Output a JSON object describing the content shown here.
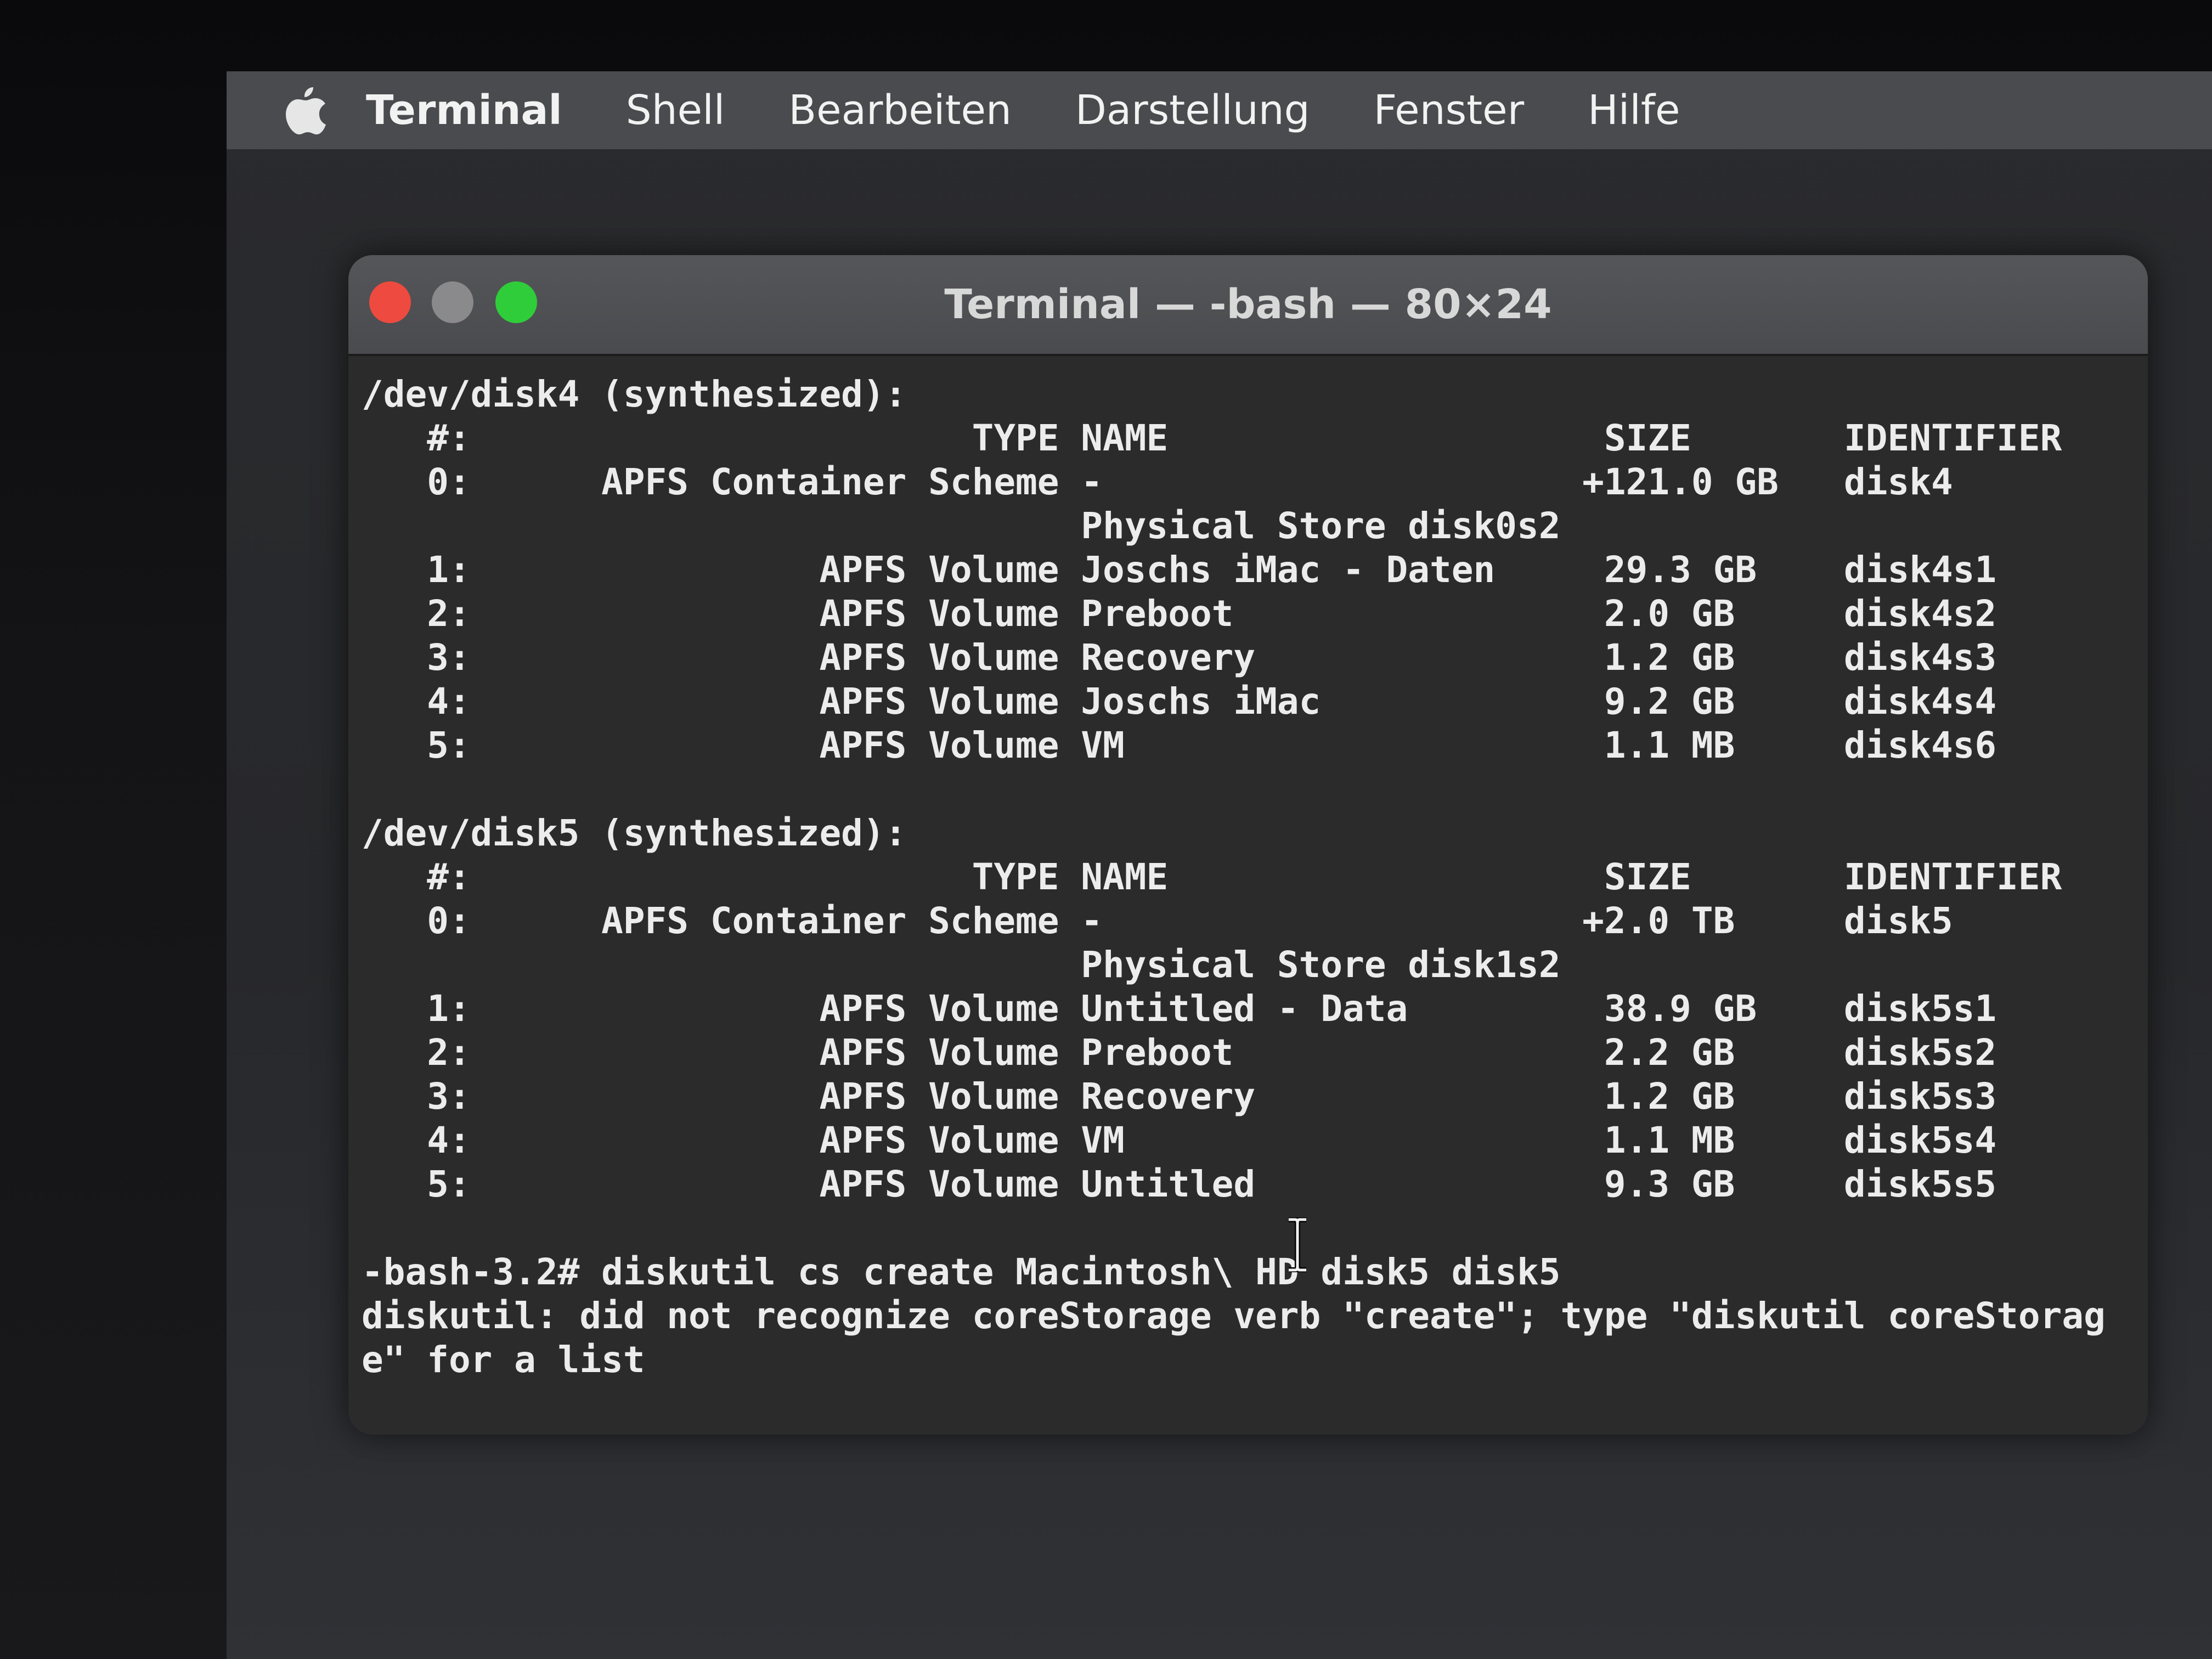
{
  "menubar": {
    "app_name": "Terminal",
    "items": [
      "Shell",
      "Bearbeiten",
      "Darstellung",
      "Fenster",
      "Hilfe"
    ]
  },
  "window": {
    "title": "Terminal — -bash — 80×24"
  },
  "terminal": {
    "lines": [
      "/dev/disk4 (synthesized):",
      "   #:                       TYPE NAME                    SIZE       IDENTIFIER",
      "   0:      APFS Container Scheme -                      +121.0 GB   disk4",
      "                                 Physical Store disk0s2",
      "   1:                APFS Volume Joschs iMac - Daten     29.3 GB    disk4s1",
      "   2:                APFS Volume Preboot                 2.0 GB     disk4s2",
      "   3:                APFS Volume Recovery                1.2 GB     disk4s3",
      "   4:                APFS Volume Joschs iMac             9.2 GB     disk4s4",
      "   5:                APFS Volume VM                      1.1 MB     disk4s6",
      "",
      "/dev/disk5 (synthesized):",
      "   #:                       TYPE NAME                    SIZE       IDENTIFIER",
      "   0:      APFS Container Scheme -                      +2.0 TB     disk5",
      "                                 Physical Store disk1s2",
      "   1:                APFS Volume Untitled - Data         38.9 GB    disk5s1",
      "   2:                APFS Volume Preboot                 2.2 GB     disk5s2",
      "   3:                APFS Volume Recovery                1.2 GB     disk5s3",
      "   4:                APFS Volume VM                      1.1 MB     disk5s4",
      "   5:                APFS Volume Untitled                9.3 GB     disk5s5",
      "",
      "-bash-3.2# diskutil cs create Macintosh\\ HD disk5 disk5",
      "diskutil: did not recognize coreStorage verb \"create\"; type \"diskutil coreStorag",
      "e\" for a list"
    ]
  },
  "colors": {
    "menubar_bg": "#4a4b4e",
    "terminal_bg": "#2b2b2b",
    "text": "#ececec",
    "close": "#ee4a3f",
    "minimize": "#8a8a8c",
    "zoom": "#2fcd3a"
  }
}
